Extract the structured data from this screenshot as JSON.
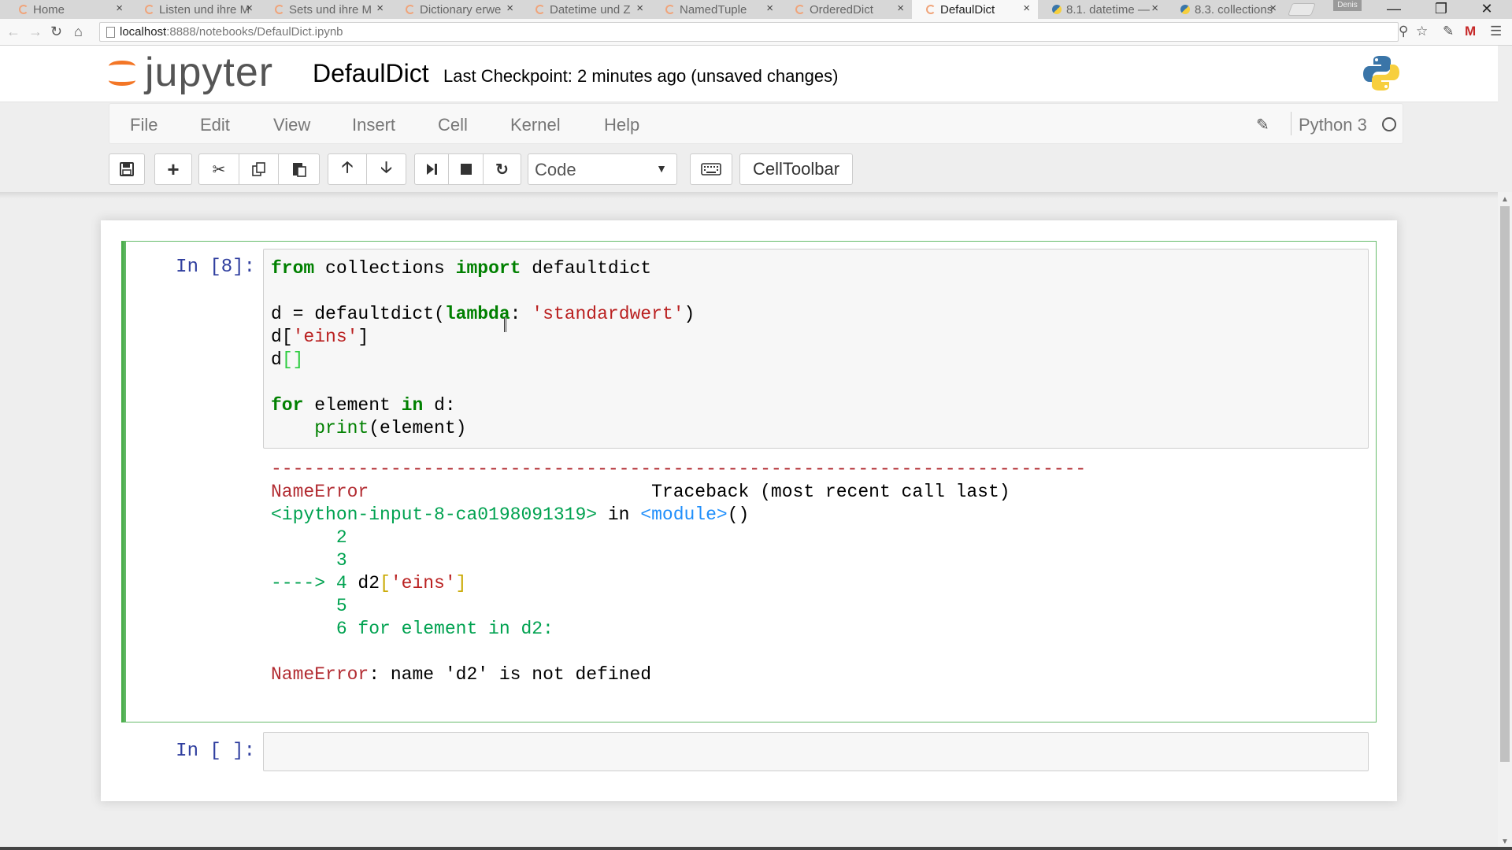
{
  "browser": {
    "tabs": [
      {
        "label": "Home",
        "icon": "jupyter-favicon-icon",
        "active": false
      },
      {
        "label": "Listen und ihre M",
        "icon": "jupyter-favicon-icon",
        "active": false
      },
      {
        "label": "Sets und ihre M",
        "icon": "jupyter-favicon-icon",
        "active": false
      },
      {
        "label": "Dictionary erwe",
        "icon": "jupyter-favicon-icon",
        "active": false
      },
      {
        "label": "Datetime und Z",
        "icon": "jupyter-favicon-icon",
        "active": false
      },
      {
        "label": "NamedTuple",
        "icon": "jupyter-favicon-icon",
        "active": false
      },
      {
        "label": "OrderedDict",
        "icon": "jupyter-favicon-icon",
        "active": false
      },
      {
        "label": "DefaulDict",
        "icon": "jupyter-favicon-icon",
        "active": true
      },
      {
        "label": "8.1. datetime —",
        "icon": "python-favicon-icon",
        "active": false
      },
      {
        "label": "8.3. collections",
        "icon": "python-favicon-icon",
        "active": false
      }
    ],
    "close_glyph": "×",
    "user_badge": "Denis",
    "url_host": "localhost",
    "url_path": ":8888/notebooks/DefaulDict.ipynb"
  },
  "header": {
    "logo_text": "jupyter",
    "notebook_name": "DefaulDict",
    "checkpoint": "Last Checkpoint: 2 minutes ago (unsaved changes)"
  },
  "menubar": {
    "items": [
      "File",
      "Edit",
      "View",
      "Insert",
      "Cell",
      "Kernel",
      "Help"
    ],
    "kernel_name": "Python 3"
  },
  "toolbar": {
    "cell_type": "Code",
    "celltoolbar_label": "CellToolbar"
  },
  "cells": [
    {
      "prompt": "In [8]:",
      "code": {
        "l1_kw1": "from",
        "l1_mid": " collections ",
        "l1_kw2": "import",
        "l1_end": " defaultdict",
        "l3_a": "d = defaultdict(",
        "l3_kw": "lambda",
        "l3_b": ": ",
        "l3_str": "'standardwert'",
        "l3_c": ")",
        "l4_a": "d[",
        "l4_str": "'eins'",
        "l4_b": "]",
        "l5_a": "d",
        "l5_brk": "[]",
        "l7_kw1": "for",
        "l7_mid": " element ",
        "l7_kw2": "in",
        "l7_end": " d:",
        "l8_indent": "    ",
        "l8_fn": "print",
        "l8_end": "(element)"
      },
      "output": {
        "dashes": "---------------------------------------------------------------------------",
        "err_name": "NameError",
        "traceback_gap": "                          ",
        "traceback": "Traceback (most recent call last)",
        "ipython_input": "<ipython-input-8-ca0198091319>",
        "in_word": " in ",
        "module": "<module>",
        "parens": "()",
        "l2": "      2",
        "l3": "      3",
        "arrow": "----> 4 ",
        "l4_code": "d2",
        "l4_lbr": "[",
        "l4_str": "'eins'",
        "l4_rbr": "]",
        "l5": "      5",
        "l6_num": "      6 ",
        "l6_code": "for element in d2:",
        "final_name": "NameError",
        "final_msg": ": name 'd2' is not defined"
      }
    },
    {
      "prompt": "In [ ]:"
    }
  ]
}
